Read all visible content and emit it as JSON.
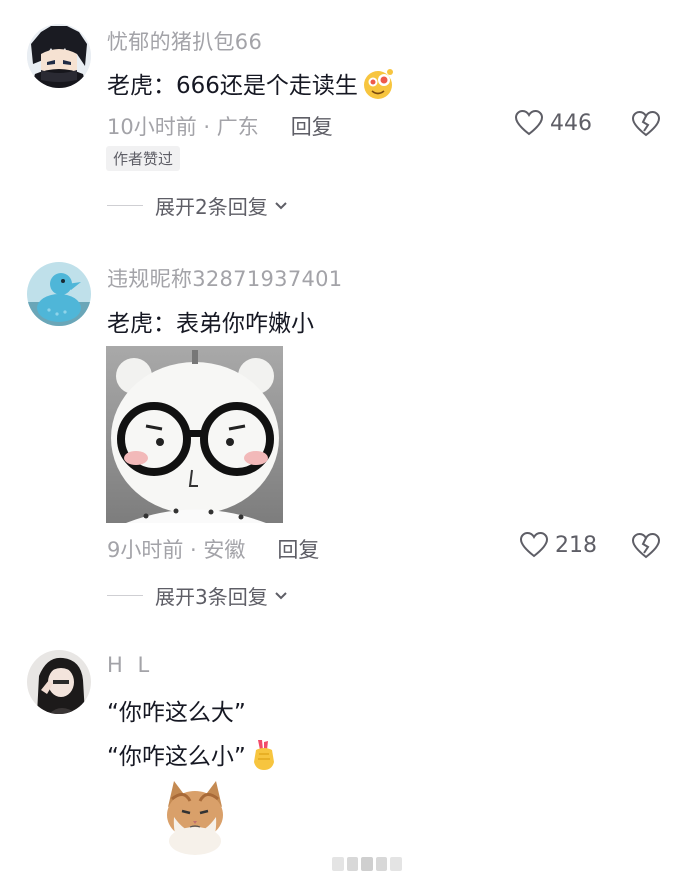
{
  "comments": [
    {
      "username": "忧郁的猪扒包66",
      "text": "老虎：666还是个走读生",
      "emoji": "star-eyes-emoji",
      "time_location": "10小时前 · 广东",
      "reply_label": "回复",
      "likes": "446",
      "author_badge": "作者赞过",
      "expand_label": "展开2条回复"
    },
    {
      "username": "违规昵称32871937401",
      "text": "老虎：表弟你咋嫩小",
      "image": "bear-with-glasses-sticker",
      "time_location": "9小时前 · 安徽",
      "reply_label": "回复",
      "likes": "218",
      "expand_label": "展开3条回复"
    },
    {
      "username": "H L",
      "text_line1": "“你咋这么大”",
      "text_line2": "“你咋这么小”",
      "emoji": "finger-heart-emoji",
      "image": "cat-sticker"
    }
  ],
  "colors": {
    "primary_text": "#161823",
    "secondary_text": "#a3a3a8",
    "action_text": "#5e5e66",
    "badge_bg": "#f1f1f2"
  },
  "icons": [
    "heart-outline-icon",
    "broken-heart-icon",
    "chevron-down-icon"
  ]
}
